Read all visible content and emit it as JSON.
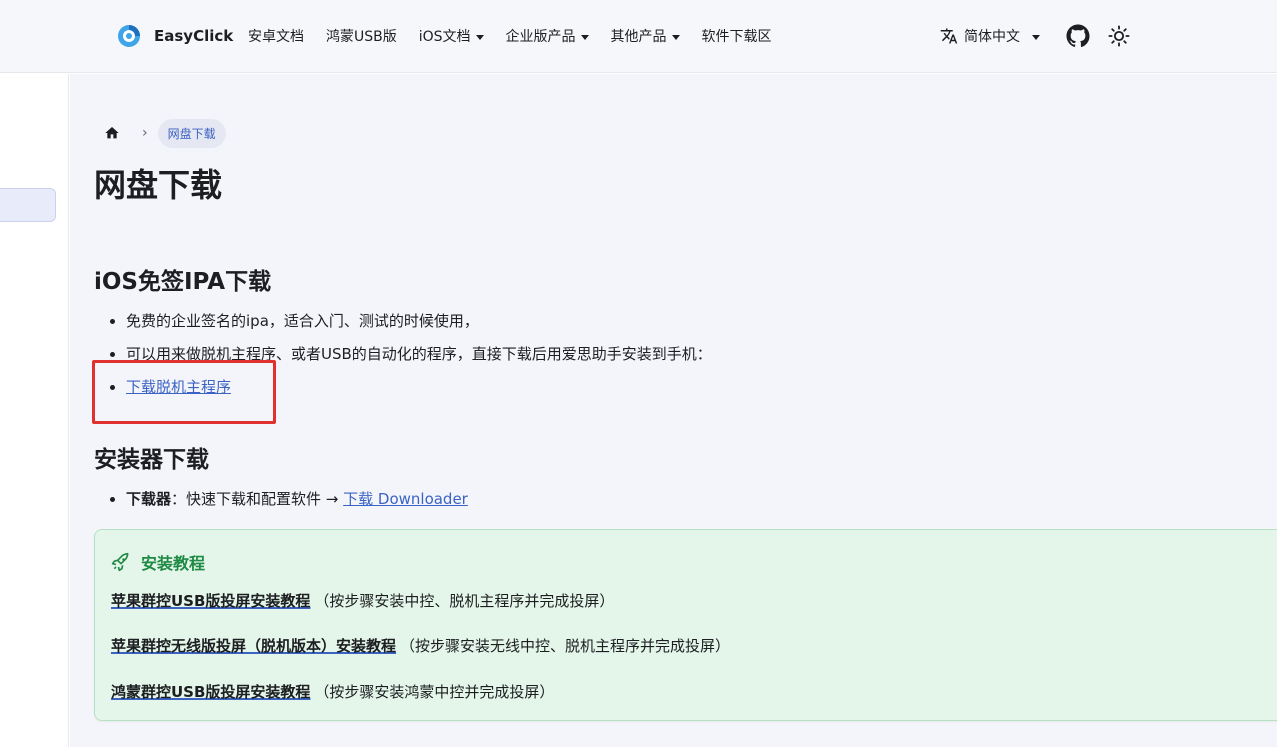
{
  "navbar": {
    "brand": "EasyClick",
    "links": [
      {
        "label": "安卓文档",
        "dropdown": false
      },
      {
        "label": "鸿蒙USB版",
        "dropdown": false
      },
      {
        "label": "iOS文档",
        "dropdown": true
      },
      {
        "label": "企业版产品",
        "dropdown": true
      },
      {
        "label": "其他产品",
        "dropdown": true
      },
      {
        "label": "软件下载区",
        "dropdown": false
      }
    ],
    "language": "简体中文"
  },
  "breadcrumb": {
    "current": "网盘下载"
  },
  "page": {
    "title": "网盘下载",
    "ios_section": {
      "heading": "iOS免签IPA下载",
      "items": [
        "免费的企业签名的ipa，适合入门、测试的时候使用，",
        "可以用来做脱机主程序、或者USB的自动化的程序，直接下载后用爱思助手安装到手机："
      ],
      "download_link": "下载脱机主程序"
    },
    "installer_section": {
      "heading": "安装器下载",
      "label": "下载器",
      "text": "：快速下载和配置软件 → ",
      "link": "下载 Downloader"
    },
    "tip": {
      "title": "安装教程",
      "rows": [
        {
          "link": "苹果群控USB版投屏安装教程",
          "note": "（按步骤安装中控、脱机主程序并完成投屏）"
        },
        {
          "link": "苹果群控无线版投屏（脱机版本）安装教程",
          "note": "（按步骤安装无线中控、脱机主程序并完成投屏）"
        },
        {
          "link": "鸿蒙群控USB版投屏安装教程",
          "note": "（按步骤安装鸿蒙中控并完成投屏）"
        }
      ]
    }
  },
  "colors": {
    "accent": "#3b63c4",
    "tip_bg": "#e4f6ea",
    "tip_title": "#1f8a44",
    "highlight": "#e03131"
  }
}
